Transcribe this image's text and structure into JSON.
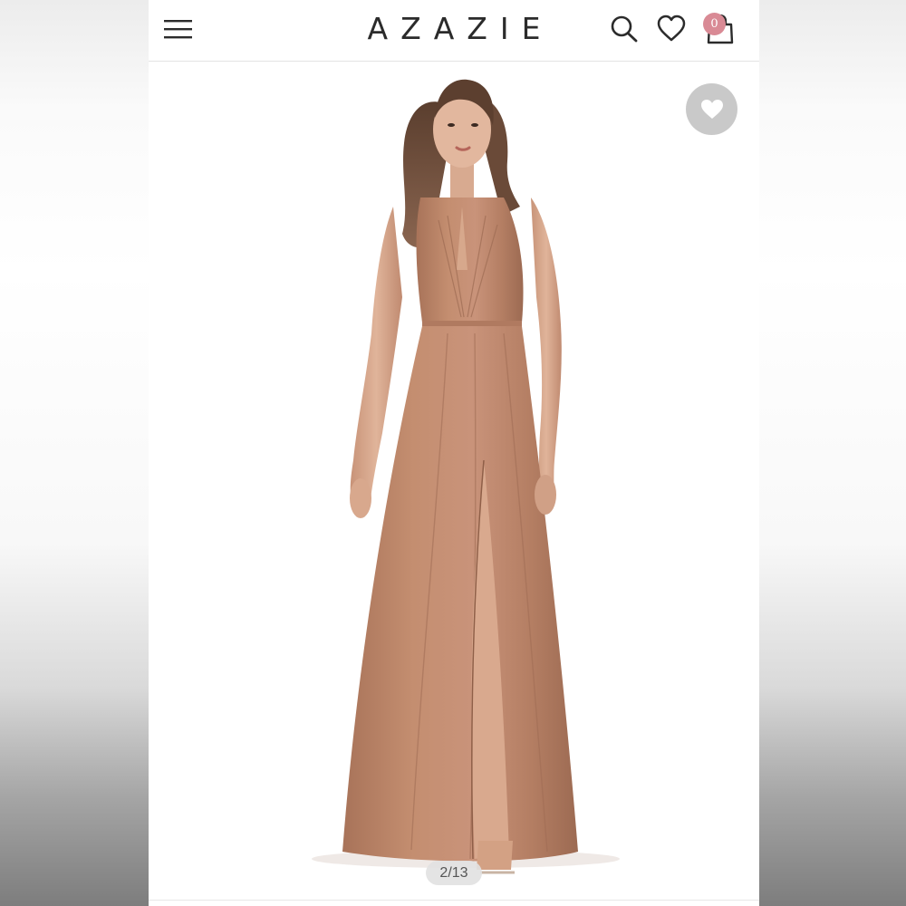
{
  "header": {
    "brand": "AZAZIE",
    "cart_count": "0",
    "icons": {
      "menu": "hamburger-menu-icon",
      "search": "search-icon",
      "wishlist": "heart-outline-icon",
      "bag": "shopping-bag-icon"
    }
  },
  "gallery": {
    "counter": "2/13",
    "favorite_icon": "heart-filled-icon",
    "dress_color": "#c08a6c"
  },
  "colors": {
    "cart_badge": "#d98a95",
    "favorite_button": "#c9c9c9",
    "brand_text": "#2b2b2b"
  }
}
